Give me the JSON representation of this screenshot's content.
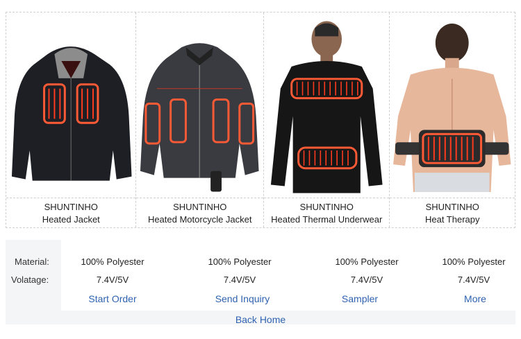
{
  "products": [
    {
      "brand": "SHUNTINHO",
      "name": "Heated Jacket",
      "image": "heated-jacket-image"
    },
    {
      "brand": "SHUNTINHO",
      "name": "Heated Motorcycle Jacket",
      "image": "heated-motorcycle-jacket-image"
    },
    {
      "brand": "SHUNTINHO",
      "name": "Heated Thermal Underwear",
      "image": "heated-thermal-underwear-image"
    },
    {
      "brand": "SHUNTINHO",
      "name": "Heat Therapy",
      "image": "heat-therapy-belt-image"
    }
  ],
  "specs": {
    "material_label": "Material:",
    "voltage_label": "Volatage:",
    "materials": [
      "100% Polyester",
      "100% Polyester",
      "100% Polyester",
      "100% Polyester"
    ],
    "voltages": [
      "7.4V/5V",
      "7.4V/5V",
      "7.4V/5V",
      "7.4V/5V"
    ]
  },
  "actions": [
    "Start Order",
    "Send Inquiry",
    "Sampler",
    "More"
  ],
  "footer": {
    "back_home": "Back Home"
  },
  "colors": {
    "link": "#2f62b0",
    "panel_bg": "#f4f5f7",
    "heat": "#ff3b1f"
  }
}
